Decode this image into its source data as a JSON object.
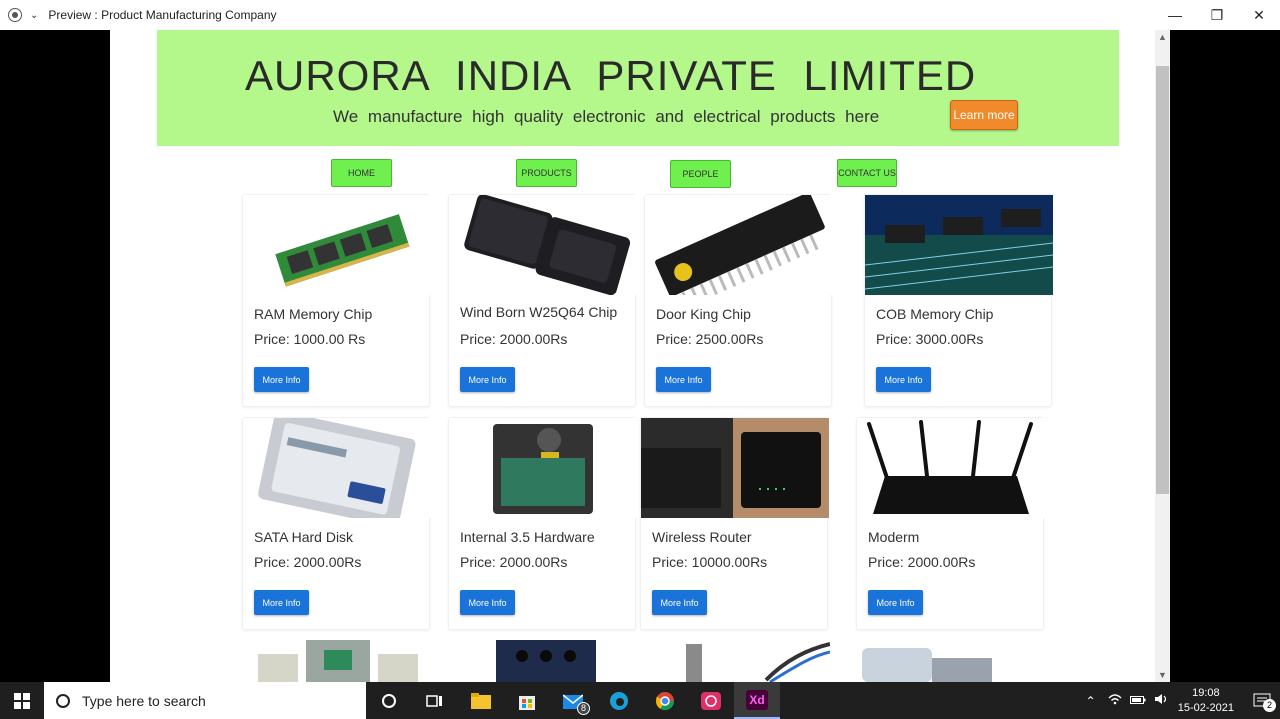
{
  "window": {
    "title": "Preview : Product Manufacturing Company",
    "minimize": "—",
    "restore": "❐",
    "close": "✕"
  },
  "header": {
    "company": "AURORA INDIA PRIVATE LIMITED",
    "tagline": "We manufacture high quality electronic and electrical products here",
    "learn_more": "Learn more"
  },
  "nav": [
    {
      "label": "HOME"
    },
    {
      "label": "PRODUCTS"
    },
    {
      "label": "PEOPLE"
    },
    {
      "label": "CONTACT US"
    }
  ],
  "products": [
    {
      "name": "RAM Memory Chip",
      "price": "Price: 1000.00 Rs",
      "button": "More Info"
    },
    {
      "name": "Wind Born W25Q64 Chip",
      "price": "Price: 2000.00Rs",
      "button": "More Info"
    },
    {
      "name": "Door King Chip",
      "price": "Price: 2500.00Rs",
      "button": "More Info"
    },
    {
      "name": "COB Memory Chip",
      "price": "Price: 3000.00Rs",
      "button": "More Info"
    },
    {
      "name": "SATA Hard Disk",
      "price": "Price: 2000.00Rs",
      "button": "More Info"
    },
    {
      "name": "Internal 3.5 Hardware",
      "price": "Price: 2000.00Rs",
      "button": "More Info"
    },
    {
      "name": "Wireless Router",
      "price": "Price: 10000.00Rs",
      "button": "More Info"
    },
    {
      "name": "Moderm",
      "price": "Price: 2000.00Rs",
      "button": "More Info"
    }
  ],
  "taskbar": {
    "search_placeholder": "Type here to search",
    "mail_badge": "8",
    "time": "19:08",
    "date": "15-02-2021",
    "notification_count": "2",
    "xd_label": "Xd"
  },
  "colors": {
    "header_bg": "#b4f88c",
    "nav_bg": "#6ff04f",
    "learn_more_bg": "#f08a2a",
    "more_info_bg": "#1a73d8"
  }
}
